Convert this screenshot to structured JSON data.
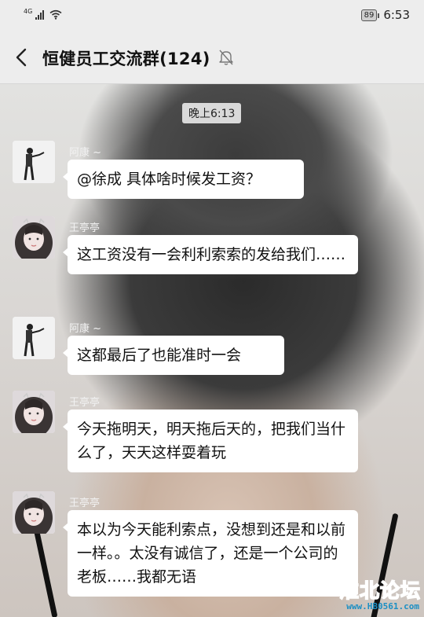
{
  "status": {
    "network": "4G",
    "battery": "89",
    "time": "6:53"
  },
  "header": {
    "title": "恒健员工交流群(124)"
  },
  "chat": {
    "time_divider": "晚上6:13",
    "messages": [
      {
        "sender": "阿康 ~",
        "text": "@徐成  具体啥时候发工资？"
      },
      {
        "sender": "王亭亭",
        "text": "这工资没有一会利利索索的发给我们……"
      },
      {
        "sender": "阿康 ~",
        "text": "这都最后了也能准时一会"
      },
      {
        "sender": "王亭亭",
        "text": "今天拖明天，明天拖后天的，把我们当什么了，天天这样耍着玩"
      },
      {
        "sender": "王亭亭",
        "text": "本以为今天能利索点，没想到还是和以前一样。。太没有诚信了，还是一个公司的老板……我都无语"
      }
    ]
  },
  "watermark": {
    "title": "淮北论坛",
    "url": "www.HB0561.com"
  }
}
